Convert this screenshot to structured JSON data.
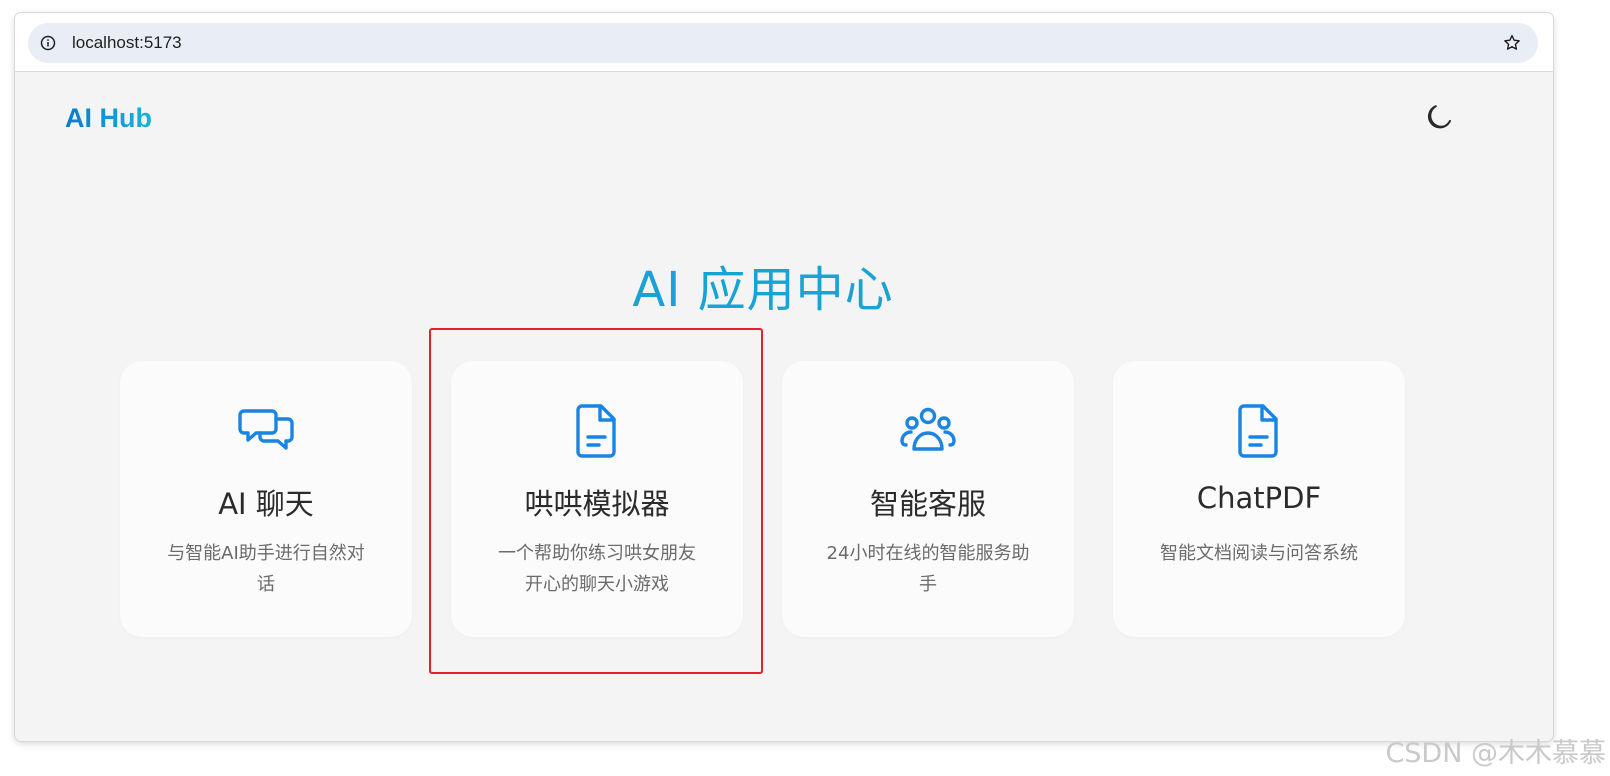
{
  "browser": {
    "url": "localhost:5173",
    "info_icon": "info-icon",
    "bookmark_icon": "star-icon"
  },
  "header": {
    "logo": "AI Hub",
    "theme_toggle_icon": "moon-icon"
  },
  "main": {
    "title": "AI 应用中心",
    "cards": [
      {
        "title": "AI 聊天",
        "description": "与智能AI助手进行自然对话",
        "icon": "chat-bubbles-icon"
      },
      {
        "title": "哄哄模拟器",
        "description": "一个帮助你练习哄女朋友开心的聊天小游戏",
        "icon": "document-icon"
      },
      {
        "title": "智能客服",
        "description": "24小时在线的智能服务助手",
        "icon": "users-group-icon"
      },
      {
        "title": "ChatPDF",
        "description": "智能文档阅读与问答系统",
        "icon": "document-icon"
      }
    ]
  },
  "colors": {
    "accent": "#1a8de0",
    "title": "#17a3d6",
    "highlight_box": "#e2212b"
  },
  "watermark": "CSDN @木木慕慕"
}
